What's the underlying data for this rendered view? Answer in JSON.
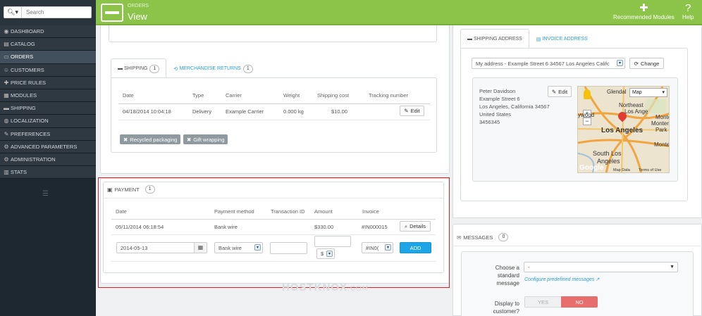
{
  "search": {
    "placeholder": "Search",
    "icon": "search-icon"
  },
  "sidebar": {
    "items": [
      {
        "label": "Dashboard",
        "icon": "dashboard-icon"
      },
      {
        "label": "Catalog",
        "icon": "catalog-icon"
      },
      {
        "label": "Orders",
        "icon": "orders-icon",
        "active": true
      },
      {
        "label": "Customers",
        "icon": "customers-icon"
      },
      {
        "label": "Price Rules",
        "icon": "price-rules-icon"
      },
      {
        "label": "Modules",
        "icon": "modules-icon"
      },
      {
        "label": "Shipping",
        "icon": "shipping-icon"
      },
      {
        "label": "Localization",
        "icon": "localization-icon"
      },
      {
        "label": "Preferences",
        "icon": "preferences-icon"
      },
      {
        "label": "Advanced Parameters",
        "icon": "advanced-parameters-icon"
      },
      {
        "label": "Administration",
        "icon": "administration-icon"
      },
      {
        "label": "Stats",
        "icon": "stats-icon"
      }
    ]
  },
  "header": {
    "breadcrumb": "Orders",
    "title": "View",
    "recommended_modules": "Recommended Modules",
    "help": "Help",
    "accent": "#8bc449"
  },
  "shipping": {
    "tab_label": "Shipping",
    "tab_count": "1",
    "returns_tab_label": "Merchandise Returns",
    "returns_count": "1",
    "columns": [
      "Date",
      "Type",
      "Carrier",
      "Weight",
      "Shipping cost",
      "Tracking number"
    ],
    "row": {
      "date": "04/18/2014 10:04:18",
      "type": "Delivery",
      "carrier": "Example Carrier",
      "weight": "0.000 kg",
      "cost": "$10.00"
    },
    "edit_label": "Edit",
    "recycled_label": "Recycled packaging",
    "gift_label": "Gift wrapping"
  },
  "payment": {
    "title": "Payment",
    "count": "1",
    "columns": [
      "Date",
      "Payment method",
      "Transaction ID",
      "Amount",
      "Invoice"
    ],
    "row": {
      "date": "05/11/2014 06:18:54",
      "method": "Bank wire",
      "transaction": "",
      "amount": "$330.00",
      "invoice": "#IN000015"
    },
    "details_label": "Details",
    "form": {
      "date": "2014-05-13",
      "method": "Bank wire",
      "transaction": "",
      "amount": "",
      "currency": "$",
      "invoice": "#IN0("
    },
    "add_label": "ADD"
  },
  "address": {
    "shipping_tab": "Shipping Address",
    "invoice_tab": "Invoice Address",
    "select_value": "My address - Example Street 6 34567 Los Angeles Califc",
    "change_label": "Change",
    "lines": [
      "Peter Davidson",
      "Example Street 6",
      "Los Angeles, California 34567",
      "United States",
      "3456345"
    ],
    "edit_label": "Edit",
    "map": {
      "type_label": "Map",
      "labels": [
        "Glendal",
        "Northeast",
        "Los Ange",
        "ywood",
        "Los Angeles",
        "Monte",
        "Monter",
        "Park",
        "South Los",
        "Angeles",
        "Montel",
        "Google",
        "Map Data",
        "Terms of Use"
      ]
    }
  },
  "messages": {
    "title": "Messages",
    "count": "0",
    "standard_label": "Choose a standard message",
    "standard_value": "-",
    "configure_link": "Configure predefined messages",
    "display_label": "Display to customer?",
    "yes": "YES",
    "no": "NO"
  },
  "watermark": {
    "main": "HOSTKNOX",
    "suffix": ".COM"
  }
}
